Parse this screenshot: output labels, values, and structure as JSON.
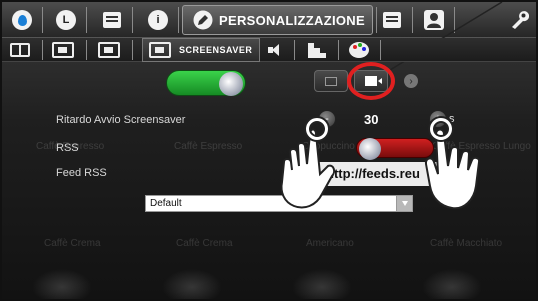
{
  "topbar": {
    "icons": [
      "water-drop-icon",
      "clock-icon",
      "card-icon",
      "info-icon",
      "pencil-icon",
      "list-icon",
      "user-icon",
      "wrench-icon"
    ],
    "active_tab_label": "PERSONALIZZAZIONE"
  },
  "subbar": {
    "active_tab_label": "SCREENSAVER"
  },
  "screensaver": {
    "enabled": true,
    "modes": [
      "photo-icon",
      "video-icon",
      "next-icon"
    ],
    "selected_mode": "video-icon",
    "delay_label": "Ritardo Avvio Screensaver",
    "delay_value": "30",
    "delay_unit": "s",
    "minus_label": "-",
    "plus_label": "+",
    "rss_label": "RSS",
    "rss_enabled": false,
    "feed_label": "Feed RSS",
    "feed_value": "http://feeds.reu",
    "select_value": "Default"
  },
  "background_labels": [
    "Caffè Espresso",
    "Caffè Espresso",
    "Cappuccino",
    "Caffè Espresso Lungo",
    "Caffè Crema",
    "Caffè Crema",
    "Americano",
    "Caffè Macchiato"
  ],
  "annotation_colors": {
    "highlight": "#e02020",
    "toggle_on": "#2db83c",
    "toggle_off": "#c01818"
  }
}
